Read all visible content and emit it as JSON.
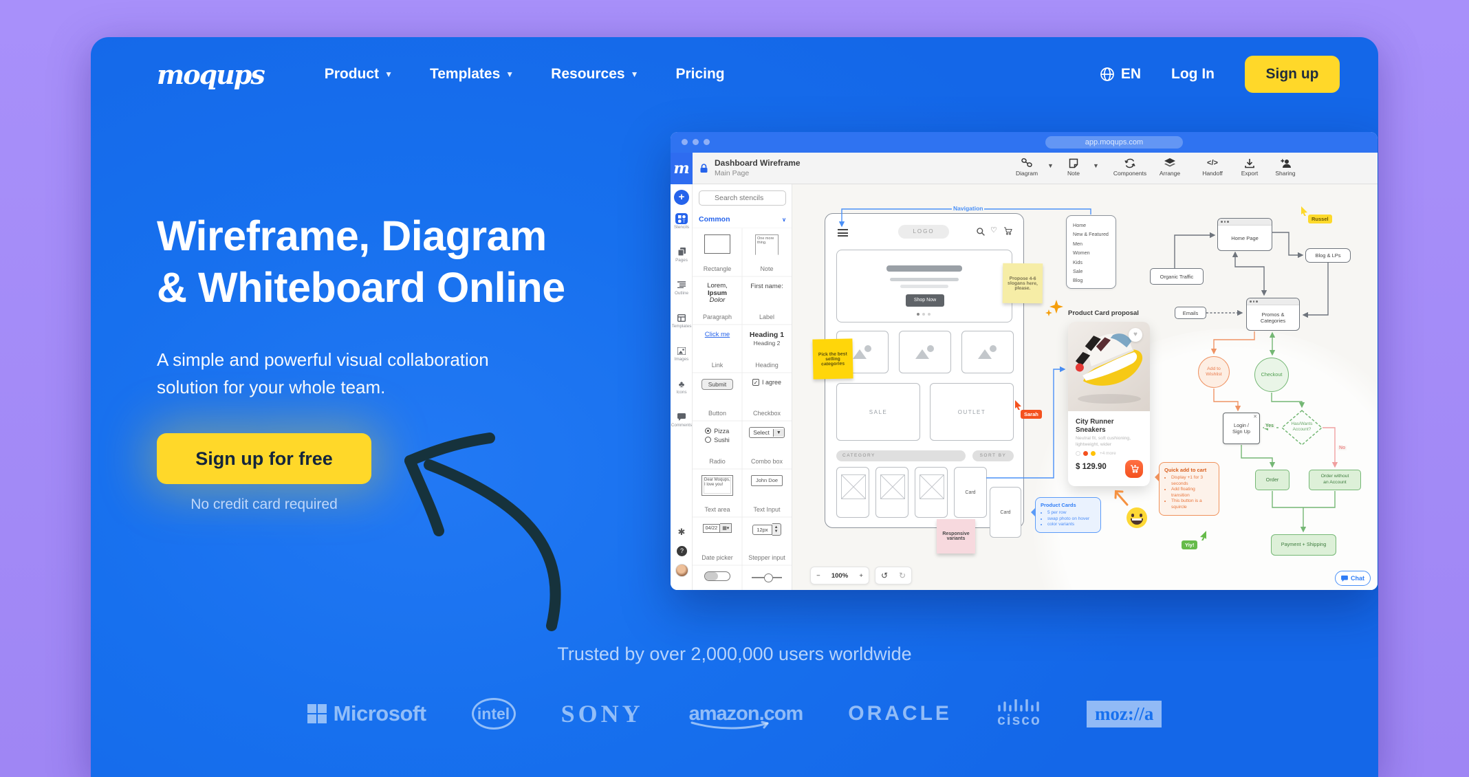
{
  "colors": {
    "purple_bg": "#A48EF9",
    "blue": "#1770EE",
    "yellow": "#FFD829",
    "arrow_navy": "#16323C"
  },
  "header": {
    "logo": "moqups",
    "nav": [
      {
        "label": "Product"
      },
      {
        "label": "Templates"
      },
      {
        "label": "Resources"
      },
      {
        "label": "Pricing"
      }
    ],
    "language": "EN",
    "login": "Log In",
    "signup": "Sign up"
  },
  "hero": {
    "title_line1": "Wireframe, Diagram",
    "title_line2": "& Whiteboard Online",
    "subtitle_line1": "A simple and powerful visual collaboration",
    "subtitle_line2": "solution for your whole team.",
    "cta": "Sign up for free",
    "cta_note": "No credit card required"
  },
  "trusted": {
    "text": "Trusted by over 2,000,000 users worldwide",
    "logos": {
      "microsoft": "Microsoft",
      "intel": "intel",
      "sony": "SONY",
      "amazon": "amazon.com",
      "oracle": "ORACLE",
      "cisco": "cisco",
      "mozilla": "moz://a"
    }
  },
  "app": {
    "chrome": {
      "url": "app.moqups.com"
    },
    "toolbar": {
      "doc_title": "Dashboard Wireframe",
      "page_name": "Main Page",
      "diagram": "Diagram",
      "note": "Note",
      "components": "Components",
      "arrange": "Arrange",
      "handoff": "Handoff",
      "export": "Export",
      "sharing": "Sharing"
    },
    "rail": {
      "stencils": "Stencils",
      "pages": "Pages",
      "outline": "Outline",
      "templates": "Templates",
      "images": "Images",
      "icons": "Icons",
      "comments": "Comments"
    },
    "panel": {
      "search_placeholder": "Search stencils",
      "section": "Common",
      "rectangle": "Rectangle",
      "note": "Note",
      "note_preview": "One more thing.",
      "paragraph": "Paragraph",
      "paragraph_l1": "Lorem,",
      "paragraph_l2": "Ipsum",
      "paragraph_l3": "Dolor",
      "label": "Label",
      "label_preview": "First name:",
      "link": "Link",
      "link_preview": "Click me",
      "heading": "Heading",
      "heading_preview1": "Heading 1",
      "heading_preview2": "Heading 2",
      "button": "Button",
      "button_preview": "Submit",
      "checkbox": "Checkbox",
      "checkbox_preview": "I agree",
      "check_glyph": "✓",
      "radio": "Radio",
      "radio_opt1": "Pizza",
      "radio_opt2": "Sushi",
      "combo": "Combo box",
      "combo_preview": "Select",
      "textarea": "Text area",
      "textarea_preview": "Dear Moqups, I love you!",
      "textinput": "Text Input",
      "textinput_preview": "John Doe",
      "datepicker": "Date picker",
      "datepicker_preview": "04/22",
      "stepper": "Stepper input",
      "stepper_preview": "12px"
    },
    "canvas": {
      "navigation_label": "Navigation",
      "wireframe": {
        "logo": "LOGO",
        "shop_now": "Shop Now",
        "sale": "SALE",
        "outlet": "OUTLET",
        "category": "CATEGORY",
        "sort_by": "SORT BY",
        "card1": "Card",
        "card2": "Card"
      },
      "menu": {
        "items": [
          "Home",
          "New & Featured",
          "Men",
          "Women",
          "Kids",
          "Sale",
          "Blog"
        ]
      },
      "stickies": {
        "slogans": "Propose 4-6 slogans here, please.",
        "categories": "Pick the best selling categories",
        "responsive": "Responsive variants"
      },
      "cursors": {
        "sarah": "Sarah",
        "russel": "Russel",
        "yiy": "Yiy!"
      },
      "product_card": {
        "heading": "Product Card proposal",
        "title_l1": "City Runner",
        "title_l2": "Sneakers",
        "desc": "Neutral fit, soft cushioning, lightweight, wider",
        "more": "+4 more",
        "price": "$ 129.90"
      },
      "blue_bubble": {
        "title": "Product Cards",
        "b1": "5 per row",
        "b2": "swap photo on hover",
        "b3": "color variants"
      },
      "orange_bubble": {
        "title": "Quick add to cart",
        "b1": "Display +1 for 3 seconds",
        "b2": "Add floating transition",
        "b3": "This button is a squircle"
      },
      "flowchart": {
        "organic": "Organic Traffic",
        "home": "Home Page",
        "blog": "Blog & LPs",
        "emails": "Emails",
        "promos_l1": "Promos &",
        "promos_l2": "Categories",
        "wishlist_l1": "Add to",
        "wishlist_l2": "Wishlist",
        "checkout": "Checkout",
        "login_l1": "Login /",
        "login_l2": "Sign Up",
        "decision_l1": "Has/Wants",
        "decision_l2": "Account?",
        "yes": "Yes",
        "no": "No",
        "order": "Order",
        "order_guest_l1": "Order without",
        "order_guest_l2": "an Account",
        "payment": "Payment + Shipping"
      },
      "controls": {
        "zoom_out": "−",
        "zoom_level": "100%",
        "zoom_in": "+",
        "chat": "Chat"
      }
    }
  }
}
